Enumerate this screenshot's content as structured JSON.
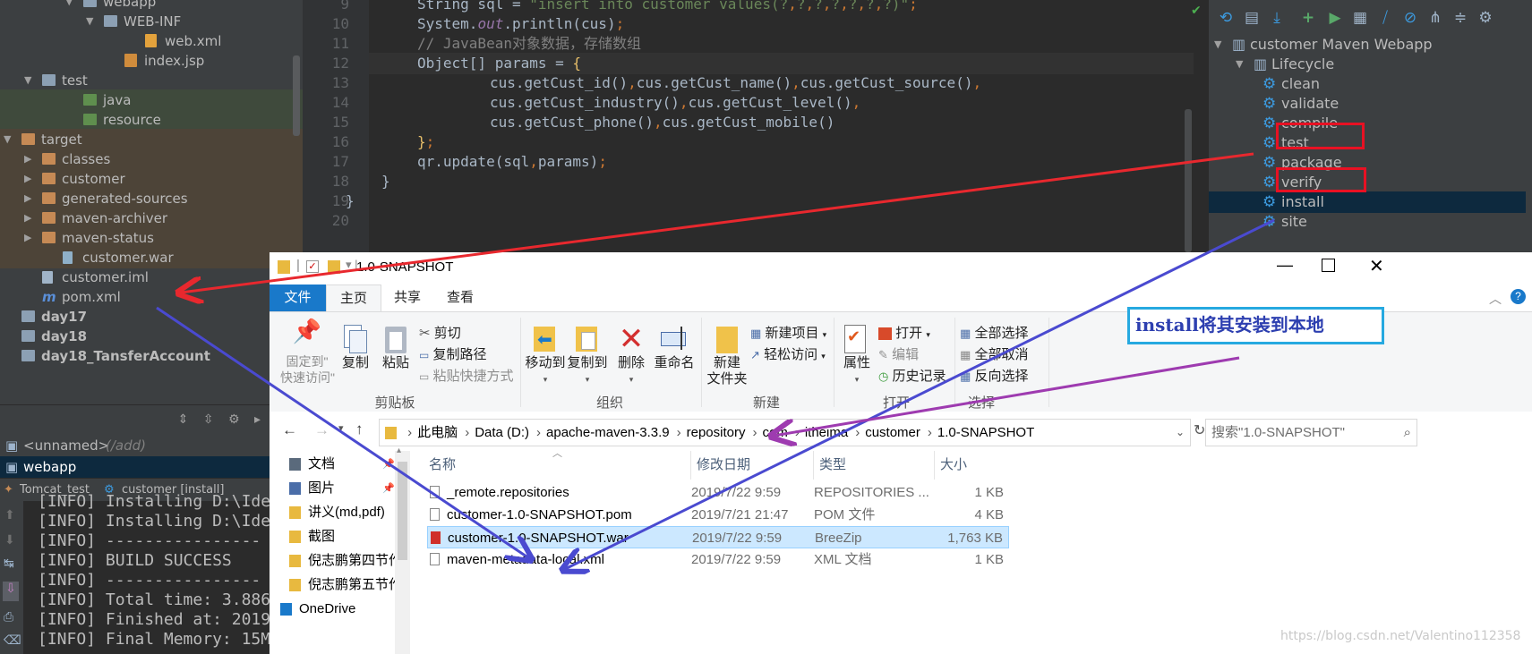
{
  "project_tree": {
    "items": [
      {
        "label": "webapp",
        "depth": 3,
        "icon": "folder",
        "expanded": true
      },
      {
        "label": "WEB-INF",
        "depth": 4,
        "icon": "folder",
        "expanded": true
      },
      {
        "label": "web.xml",
        "depth": 6,
        "icon": "xml-file",
        "expanded": null
      },
      {
        "label": "index.jsp",
        "depth": 5,
        "icon": "jsp-file",
        "expanded": null
      },
      {
        "label": "test",
        "depth": 1,
        "icon": "folder",
        "expanded": true
      },
      {
        "label": "java",
        "depth": 3,
        "icon": "folder-green",
        "expanded": null
      },
      {
        "label": "resource",
        "depth": 3,
        "icon": "folder-green",
        "expanded": null
      },
      {
        "label": "target",
        "depth": 0,
        "icon": "folder-brown",
        "expanded": true
      },
      {
        "label": "classes",
        "depth": 1,
        "icon": "folder-brown",
        "expanded": false
      },
      {
        "label": "customer",
        "depth": 1,
        "icon": "folder-brown",
        "expanded": false
      },
      {
        "label": "generated-sources",
        "depth": 1,
        "icon": "folder-brown",
        "expanded": false
      },
      {
        "label": "maven-archiver",
        "depth": 1,
        "icon": "folder-brown",
        "expanded": false
      },
      {
        "label": "maven-status",
        "depth": 1,
        "icon": "folder-brown",
        "expanded": false
      },
      {
        "label": "customer.war",
        "depth": 2,
        "icon": "war-file",
        "expanded": null
      },
      {
        "label": "customer.iml",
        "depth": 1,
        "icon": "iml-file",
        "expanded": null
      },
      {
        "label": "pom.xml",
        "depth": 1,
        "icon": "maven",
        "expanded": null
      },
      {
        "label": "day17",
        "depth": 0,
        "icon": "folder",
        "expanded": null,
        "bold": true
      },
      {
        "label": "day18",
        "depth": 0,
        "icon": "folder",
        "expanded": null,
        "bold": true
      },
      {
        "label": "day18_TansferAccount",
        "depth": 0,
        "icon": "folder",
        "expanded": null,
        "bold": true
      }
    ]
  },
  "editor": {
    "lines": [
      {
        "num": "9",
        "text": "String sql = \"insert into customer values(?,?,?,?,?,?,?)\";"
      },
      {
        "num": "10",
        "text": "System.out.println(cus);"
      },
      {
        "num": "11",
        "text": "// JavaBean对象数据，存储数组"
      },
      {
        "num": "12",
        "text": "Object[] params = {"
      },
      {
        "num": "13",
        "text": "cus.getCust_id(),cus.getCust_name(),cus.getCust_source(),"
      },
      {
        "num": "14",
        "text": "cus.getCust_industry(),cus.getCust_level(),"
      },
      {
        "num": "15",
        "text": "cus.getCust_phone(),cus.getCust_mobile()"
      },
      {
        "num": "16",
        "text": "};"
      },
      {
        "num": "17",
        "text": "qr.update(sql,params);"
      },
      {
        "num": "18",
        "text": "}"
      },
      {
        "num": "19",
        "text": "}"
      },
      {
        "num": "20",
        "text": ""
      }
    ]
  },
  "maven": {
    "project": "customer Maven Webapp",
    "lifecycle_label": "Lifecycle",
    "goals": [
      "clean",
      "validate",
      "compile",
      "test",
      "package",
      "verify",
      "install",
      "site"
    ],
    "selected_goal": "install",
    "highlighted_goals": [
      "compile",
      "package"
    ]
  },
  "ide_bottom": {
    "db_row1": "<unnamed>",
    "db_row1_suffix": "(/add)",
    "db_row2": "webapp",
    "run_tab1": "Tomcat_test",
    "run_tab2": "customer [install]",
    "console": [
      "[INFO] Installing D:\\Ide",
      "[INFO] Installing D:\\Ide",
      "[INFO] ----------------",
      "[INFO] BUILD SUCCESS",
      "[INFO] ----------------",
      "[INFO] Total time: 3.886",
      "[INFO] Finished at: 2019",
      "[INFO] Final Memory: 15M"
    ]
  },
  "explorer": {
    "title": "1.0-SNAPSHOT",
    "tabs": [
      "文件",
      "主页",
      "共享",
      "查看"
    ],
    "active_tab": "主页",
    "ribbon": {
      "pin": "固定到\"\n快速访问\"",
      "copy": "复制",
      "paste": "粘贴",
      "cut": "剪切",
      "copy_path": "复制路径",
      "paste_shortcut": "粘贴快捷方式",
      "clipboard_group": "剪贴板",
      "move_to": "移动到",
      "copy_to": "复制到",
      "delete": "删除",
      "rename": "重命名",
      "organize_group": "组织",
      "new_folder": "新建\n文件夹",
      "new_item": "新建项目",
      "easy_access": "轻松访问",
      "new_group": "新建",
      "properties": "属性",
      "open": "打开",
      "edit": "编辑",
      "history": "历史记录",
      "open_group": "打开",
      "select_all": "全部选择",
      "select_none": "全部取消",
      "invert_selection": "反向选择",
      "select_group": "选择"
    },
    "breadcrumb": [
      "此电脑",
      "Data (D:)",
      "apache-maven-3.3.9",
      "repository",
      "com",
      "itheima",
      "customer",
      "1.0-SNAPSHOT"
    ],
    "search_placeholder": "搜索\"1.0-SNAPSHOT\"",
    "nav": [
      "文档",
      "图片",
      "讲义(md,pdf)",
      "截图",
      "倪志鹏第四节作业",
      "倪志鹏第五节作业",
      "OneDrive"
    ],
    "columns": [
      "名称",
      "修改日期",
      "类型",
      "大小"
    ],
    "files": [
      {
        "name": "_remote.repositories",
        "date": "2019/7/22 9:59",
        "type": "REPOSITORIES ...",
        "size": "1 KB",
        "icon": "file"
      },
      {
        "name": "customer-1.0-SNAPSHOT.pom",
        "date": "2019/7/21 21:47",
        "type": "POM 文件",
        "size": "4 KB",
        "icon": "file"
      },
      {
        "name": "customer-1.0-SNAPSHOT.war",
        "date": "2019/7/22 9:59",
        "type": "BreeZip",
        "size": "1,763 KB",
        "icon": "breezip",
        "selected": true
      },
      {
        "name": "maven-metadata-local.xml",
        "date": "2019/7/22 9:59",
        "type": "XML 文档",
        "size": "1 KB",
        "icon": "xml"
      }
    ]
  },
  "annotation": "install将其安装到本地",
  "watermark": "https://blog.csdn.net/Valentino112358"
}
